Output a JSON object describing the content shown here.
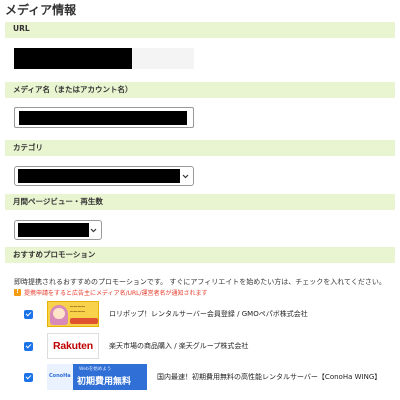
{
  "page": {
    "title": "メディア情報"
  },
  "sections": {
    "url": {
      "label": "URL"
    },
    "media_name": {
      "label": "メディア名（またはアカウント名）"
    },
    "category": {
      "label": "カテゴリ"
    },
    "monthly_pv": {
      "label": "月間ページビュー・再生数"
    },
    "promotions": {
      "label": "おすすめプロモーション"
    }
  },
  "promotions": {
    "intro": "即時提携されるおすすめのプロモーションです。 すぐにアフィリエイトを始めたい方は、チェックを入れてください。",
    "notice": "提携申請をすると広告主にメディア名/URL/運営者名が通知されます",
    "items": [
      {
        "name": "ロリポップ！レンタルサーバー会員登録 / GMOペパボ株式会社",
        "checked": true,
        "logo": "lolipop-banner"
      },
      {
        "name": "楽天市場の商品購入 / 楽天グループ株式会社",
        "checked": true,
        "logo": "rakuten-logo",
        "logo_text": "Rakuten"
      },
      {
        "name": "国内最速！初期費用無料の高性能レンタルサーバー【ConoHa WING】",
        "checked": true,
        "logo": "conoha-banner",
        "logo_brand": "ConoHa",
        "logo_small": "Webを始めよう",
        "logo_big": "初期費用無料"
      }
    ]
  },
  "colors": {
    "section_bar": "#e9f5d0",
    "notice_text": "#e53b2a",
    "checkbox": "#1a73e8",
    "warning_icon": "#f39c12"
  }
}
